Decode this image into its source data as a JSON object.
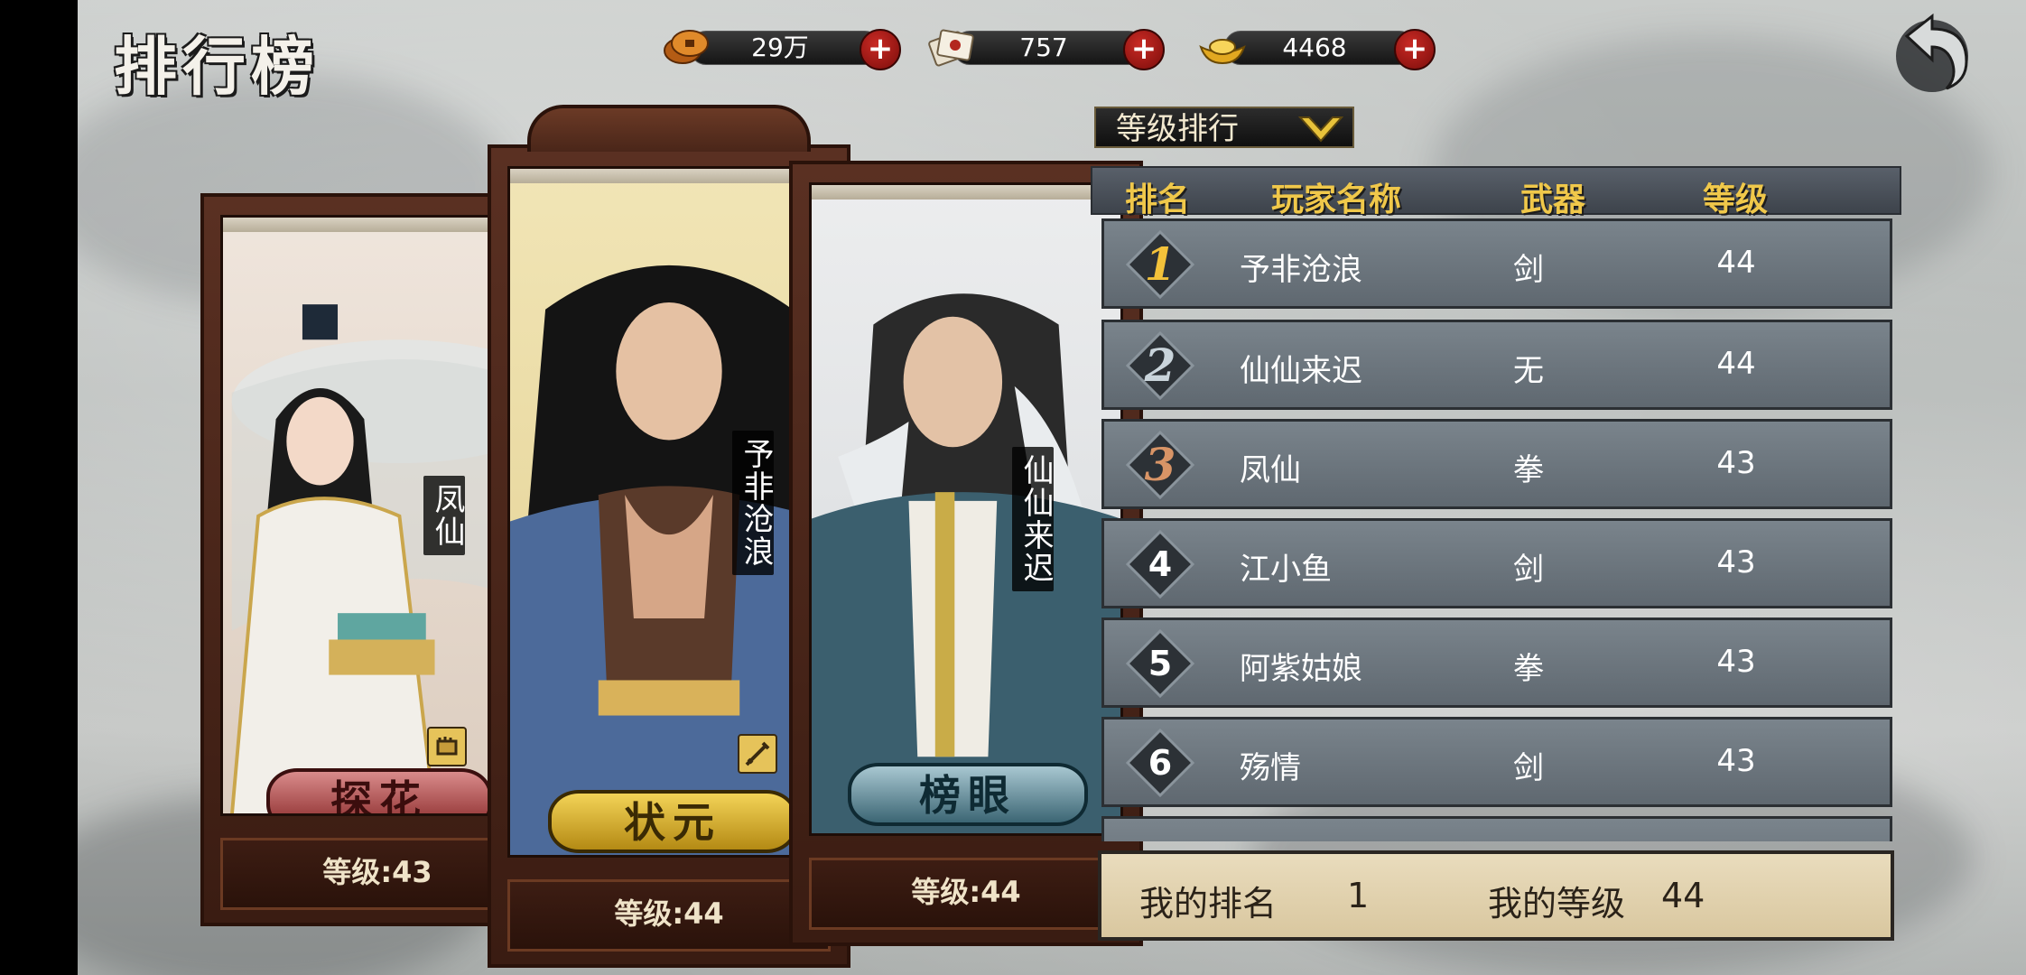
{
  "page_title": "排行榜",
  "currencies": [
    {
      "name": "coins",
      "icon": "coin-icon",
      "value": "29万"
    },
    {
      "name": "tickets",
      "icon": "scroll-ticket-icon",
      "value": "757"
    },
    {
      "name": "gold",
      "icon": "gold-ingot-icon",
      "value": "4468"
    }
  ],
  "plus_label": "+",
  "sort_dropdown": {
    "selected": "等级排行"
  },
  "table": {
    "headers": {
      "rank": "排名",
      "player": "玩家名称",
      "weapon": "武器",
      "level": "等级"
    },
    "rows": [
      {
        "rank": "1",
        "name": "予非沧浪",
        "weapon": "剑",
        "level": "44"
      },
      {
        "rank": "2",
        "name": "仙仙来迟",
        "weapon": "无",
        "level": "44"
      },
      {
        "rank": "3",
        "name": "凤仙",
        "weapon": "拳",
        "level": "43"
      },
      {
        "rank": "4",
        "name": "江小鱼",
        "weapon": "剑",
        "level": "43"
      },
      {
        "rank": "5",
        "name": "阿紫姑娘",
        "weapon": "拳",
        "level": "43"
      },
      {
        "rank": "6",
        "name": "殇情",
        "weapon": "剑",
        "level": "43"
      }
    ]
  },
  "my_stats": {
    "rank_label": "我的排名",
    "rank": "1",
    "level_label": "我的等级",
    "level": "44"
  },
  "podium": {
    "third": {
      "title": "探花",
      "name": "凤仙",
      "level_text": "等级:43"
    },
    "first": {
      "title": "状元",
      "name": "予非沧浪",
      "level_text": "等级:44"
    },
    "second": {
      "title": "榜眼",
      "name": "仙仙来迟",
      "level_text": "等级:44"
    }
  },
  "colors": {
    "header_text": "#f0c84a",
    "frame_wood": "#4a2619",
    "first_bg": "#e8d8a4",
    "third_bg": "#e9d9cf",
    "second_bg": "#d9dcdf",
    "plus_red": "#a9181a"
  }
}
